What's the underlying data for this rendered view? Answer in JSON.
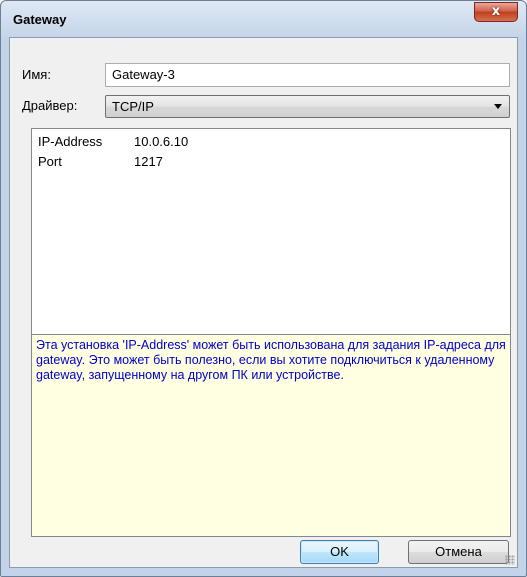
{
  "window": {
    "title": "Gateway",
    "close_label": "x"
  },
  "form": {
    "name_label": "Имя:",
    "name_value": "Gateway-3",
    "driver_label": "Драйвер:",
    "driver_value": "TCP/IP"
  },
  "properties": [
    {
      "key": "IP-Address",
      "value": "10.0.6.10"
    },
    {
      "key": "Port",
      "value": "1217"
    }
  ],
  "help_text": "Эта установка 'IP-Address' может быть использована для задания IP-адреса для gateway. Это может быть полезно, если вы хотите подключиться к удаленному gateway, запущенному на другом ПК или устройстве.",
  "buttons": {
    "ok": "OK",
    "cancel": "Отмена"
  },
  "colors": {
    "help_background": "#ffffe1",
    "help_text": "#0000cc",
    "close_button": "#c0401f"
  }
}
